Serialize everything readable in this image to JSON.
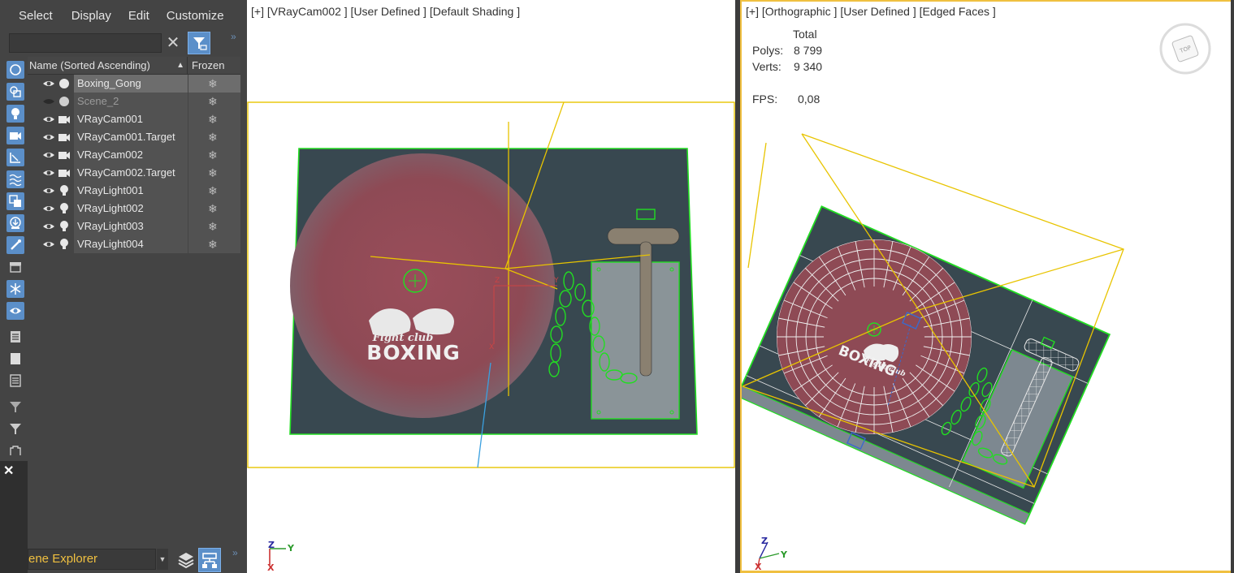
{
  "menubar": {
    "items": [
      "Select",
      "Display",
      "Edit",
      "Customize"
    ]
  },
  "explorer": {
    "search_placeholder": "",
    "columns": {
      "name": "Name (Sorted Ascending)",
      "frozen": "Frozen"
    },
    "rows": [
      {
        "name": "Boxing_Gong",
        "type": "geometry",
        "visible": true,
        "selected": true
      },
      {
        "name": "Scene_2",
        "type": "geometry",
        "visible": false,
        "selected": false
      },
      {
        "name": "VRayCam001",
        "type": "camera",
        "visible": true,
        "selected": false
      },
      {
        "name": "VRayCam001.Target",
        "type": "camera",
        "visible": true,
        "selected": false
      },
      {
        "name": "VRayCam002",
        "type": "camera",
        "visible": true,
        "selected": false
      },
      {
        "name": "VRayCam002.Target",
        "type": "camera",
        "visible": true,
        "selected": false
      },
      {
        "name": "VRayLight001",
        "type": "light",
        "visible": true,
        "selected": false
      },
      {
        "name": "VRayLight002",
        "type": "light",
        "visible": true,
        "selected": false
      },
      {
        "name": "VRayLight003",
        "type": "light",
        "visible": true,
        "selected": false
      },
      {
        "name": "VRayLight004",
        "type": "light",
        "visible": true,
        "selected": false
      }
    ],
    "explorer_name": "ene Explorer"
  },
  "viewport_left": {
    "label": "[+] [VRayCam002 ] [User Defined ] [Default Shading ]",
    "logo_line1": "Fight club",
    "logo_line2": "BOXING",
    "axis_z": "Z",
    "axis_y": "Y",
    "axis_x": "X"
  },
  "viewport_right": {
    "label": "[+] [Orthographic ] [User Defined ] [Edged Faces ]",
    "stats": {
      "total_label": "Total",
      "polys_label": "Polys:",
      "polys_value": "8 799",
      "verts_label": "Verts:",
      "verts_value": "9 340",
      "fps_label": "FPS:",
      "fps_value": "0,08"
    },
    "viewcube_label": "TOP",
    "logo_line1": "Fight club",
    "logo_line2": "BOXING",
    "axis_z": "Z",
    "axis_y": "Y",
    "axis_x": "X"
  },
  "colors": {
    "selection_green": "#22dd22",
    "camera_yellow": "#e8c400",
    "board": "#384850",
    "gong": "#8e4a55",
    "accent_blue": "#5b8fc9",
    "explorer_name_text": "#f0c040"
  }
}
